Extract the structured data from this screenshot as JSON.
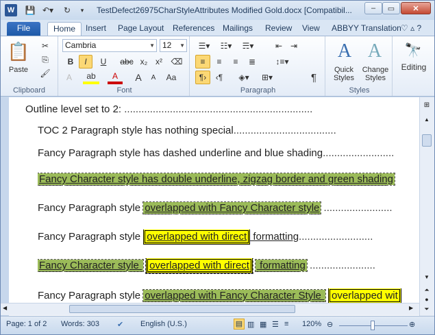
{
  "titlebar": {
    "icon": "W",
    "title": "TestDefect26975CharStyleAttributes Modified Gold.docx [Compatibil...",
    "min": "–",
    "max": "▭",
    "close": "✕"
  },
  "tabs": [
    "File",
    "Home",
    "Insert",
    "Page Layout",
    "References",
    "Mailings",
    "Review",
    "View",
    "ABBYY Translation"
  ],
  "ribbon": {
    "clipboard": {
      "label": "Clipboard",
      "paste": "Paste"
    },
    "font": {
      "label": "Font",
      "family": "Cambria",
      "size": "12",
      "bold": "B",
      "italic": "I",
      "underline": "U",
      "strike": "abc",
      "sub": "x₂",
      "sup": "x²",
      "grow": "A",
      "shrink": "A",
      "case": "Aa",
      "color": "A"
    },
    "paragraph": {
      "label": "Paragraph",
      "show": "¶"
    },
    "styles": {
      "label": "Styles",
      "quick": "Quick Styles",
      "change": "Change Styles"
    },
    "editing": {
      "label": "Editing"
    }
  },
  "doc": {
    "l1": "Outline level set to 2: ",
    "l2": "TOC 2 Paragraph style has nothing special",
    "l3": "Fancy Paragraph style has dashed underline and blue shading",
    "l4": "Fancy Character style has double underline, zigzag border and green shading",
    "l5a": "Fancy Paragraph style ",
    "l5b": "overlapped with Fancy Character style",
    "l6a": "Fancy Paragraph style ",
    "l6b": "overlapped with direct",
    "l6c": " formatting",
    "l7a": "Fancy Character style ",
    "l7b": "overlapped with direct",
    "l7c": " formatting",
    "l8a": "Fancy Paragraph style ",
    "l8b": "overlapped with Fancy Character Style ",
    "l8c": "overlapped wit"
  },
  "status": {
    "page": "Page: 1 of 2",
    "words": "Words: 303",
    "lang": "English (U.S.)",
    "zoom": "120%"
  },
  "colors": {
    "fancy_green": "#9bbb59",
    "direct_yellow": "#ffff00",
    "file_tab": "#2b5797"
  }
}
